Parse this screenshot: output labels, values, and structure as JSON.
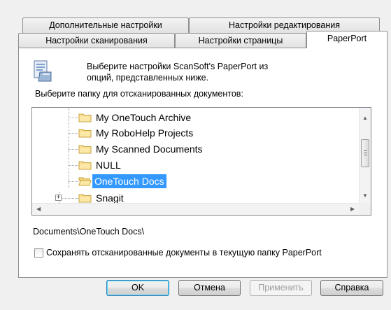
{
  "tabs": {
    "row_back": [
      "Дополнительные настройки",
      "Настройки редактирования"
    ],
    "row_front": [
      "Настройки сканирования",
      "Настройки страницы",
      "PaperPort"
    ]
  },
  "description": "Выберите настройки ScanSoft's PaperPort из опций, представленных ниже.",
  "folder_label": "Выберите папку для отсканированных документов:",
  "tree": {
    "items": [
      {
        "label": "My OneTouch Archive",
        "selected": false,
        "open": false
      },
      {
        "label": "My RoboHelp Projects",
        "selected": false,
        "open": false
      },
      {
        "label": "My Scanned Documents",
        "selected": false,
        "open": false
      },
      {
        "label": "NULL",
        "selected": false,
        "open": false
      },
      {
        "label": "OneTouch Docs",
        "selected": true,
        "open": true
      },
      {
        "label": "Snagit",
        "selected": false,
        "open": false,
        "expandable": true
      }
    ]
  },
  "path": "Documents\\OneTouch Docs\\",
  "checkbox": {
    "label": "Сохранять отсканированные документы в текущую папку PaperPort",
    "checked": false
  },
  "buttons": {
    "ok": "OK",
    "cancel": "Отмена",
    "apply": "Применить",
    "help": "Справка"
  },
  "colors": {
    "selection": "#3399ff",
    "folder": "#f5d67b"
  }
}
